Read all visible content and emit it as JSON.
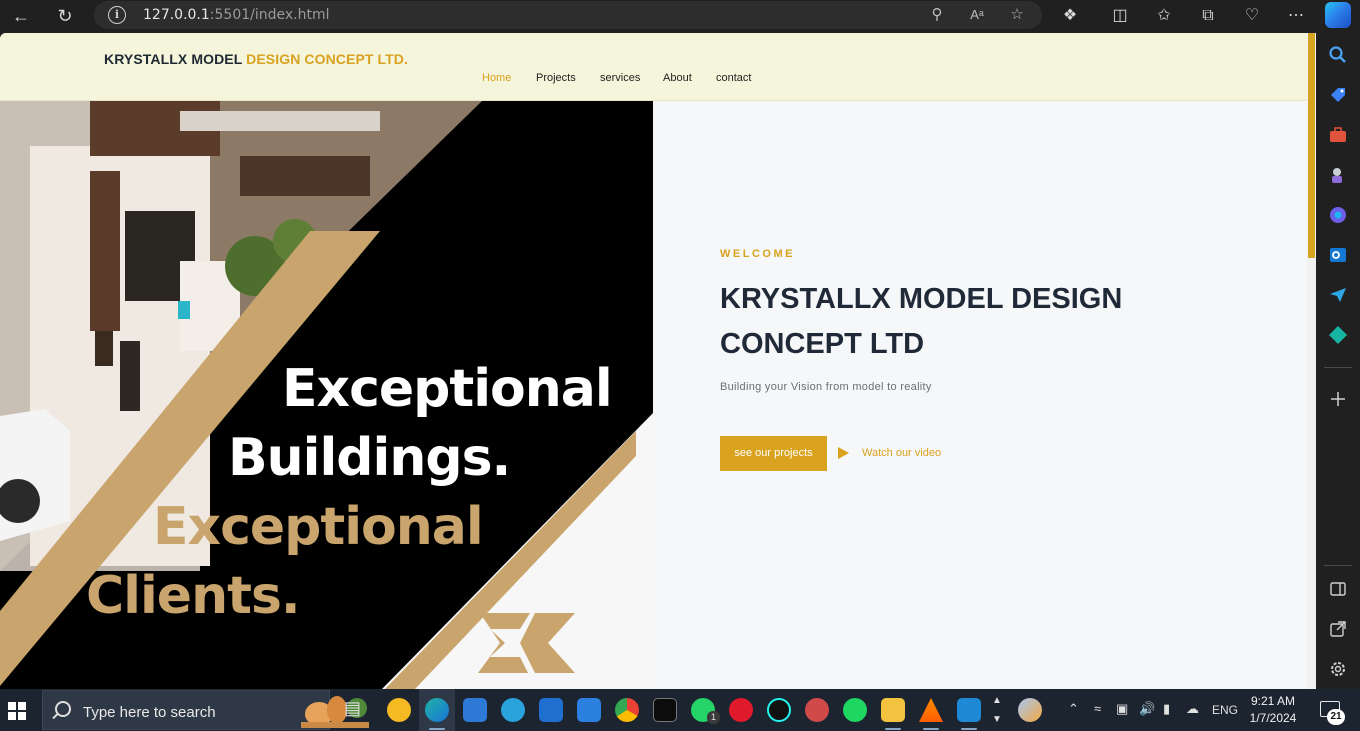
{
  "browser": {
    "url_host": "127.0.0.1",
    "url_port": ":5501",
    "url_path": "/index.html"
  },
  "site": {
    "logo_main": "KRYSTALLX MODEL ",
    "logo_accent": "DESIGN CONCEPT LTD.",
    "nav": [
      "Home",
      "Projects",
      "services",
      "About",
      "contact"
    ],
    "active_nav": "Home"
  },
  "hero": {
    "image_lines": [
      "Exceptional",
      "Buildings.",
      "Exceptional",
      "Clients."
    ],
    "welcome": "WELCOME",
    "title": "KRYSTALLX MODEL DESIGN CONCEPT LTD",
    "subtitle": "Building your Vision from model to reality",
    "primary_button": "see our projects",
    "video_link": "Watch our video"
  },
  "taskbar": {
    "search_placeholder": "Type here to search",
    "language": "ENG",
    "time": "9:21 AM",
    "date": "1/7/2024",
    "notification_count": "21",
    "whatsapp_badge": "1"
  },
  "colors": {
    "accent": "#d9a21f",
    "header_bg": "#f5f5dc",
    "title": "#1f2937"
  }
}
